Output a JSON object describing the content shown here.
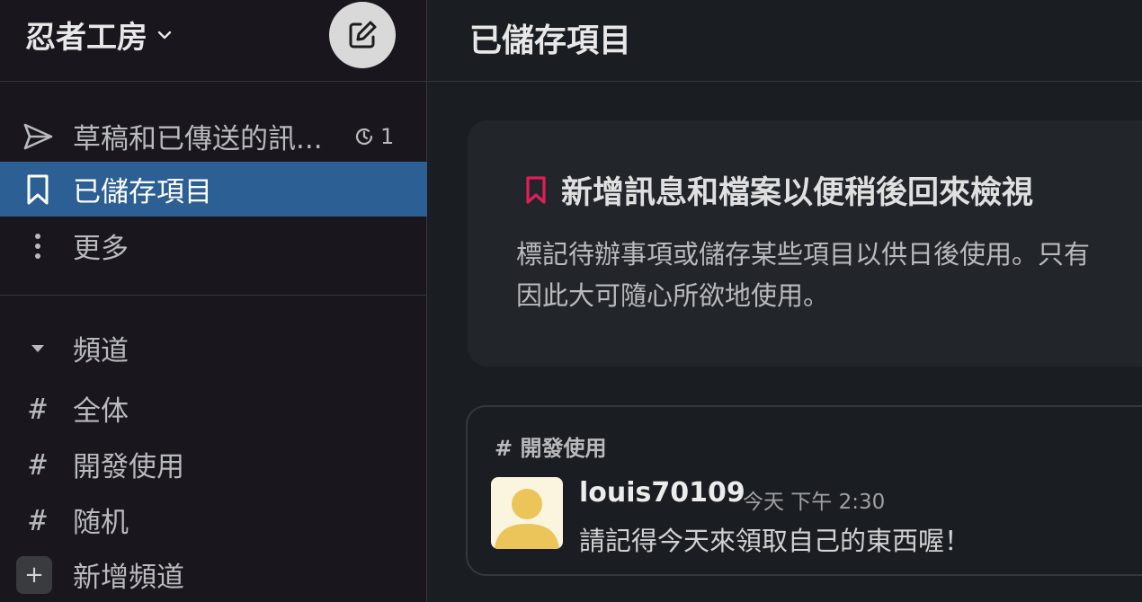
{
  "workspace": {
    "name": "忍者工房",
    "chevron_icon": "chevron-down-icon",
    "compose_icon": "compose-icon"
  },
  "sidebar": {
    "drafts": {
      "label": "草稿和已傳送的訊...",
      "badge_count": "1",
      "icon": "send-icon"
    },
    "saved": {
      "label": "已儲存項目",
      "icon": "bookmark-icon"
    },
    "more": {
      "label": "更多",
      "icon": "vertical-ellipsis-icon"
    },
    "channels_header": "頻道",
    "channels": [
      {
        "label": "全体"
      },
      {
        "label": "開發使用"
      },
      {
        "label": "随机"
      }
    ],
    "add_channel": "新增頻道"
  },
  "main": {
    "title": "已儲存項目",
    "empty_state": {
      "title": "新增訊息和檔案以便稍後回來檢視",
      "desc_line1": "標記待辦事項或儲存某些項目以供日後使用。只有",
      "desc_line2": "因此大可隨心所欲地使用。"
    },
    "message": {
      "channel": "# 開發使用",
      "author": "louis70109",
      "time": "今天 下午 2:30",
      "text": "請記得今天來領取自己的東西喔！"
    }
  },
  "colors": {
    "sidebar_bg": "#19171d",
    "main_bg": "#1a1d21",
    "active_item": "#2c5f93",
    "bookmark_accent": "#e01e5a",
    "avatar_yellow": "#ecc55a"
  }
}
